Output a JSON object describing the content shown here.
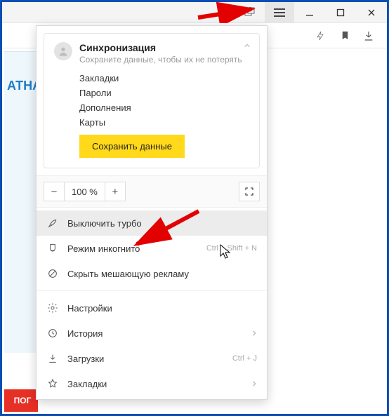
{
  "bg": {
    "left_text": "АТНА",
    "red_block": "ПОГ"
  },
  "sync": {
    "title": "Синхронизация",
    "subtitle": "Сохраните данные, чтобы их не потерять",
    "links": [
      "Закладки",
      "Пароли",
      "Дополнения",
      "Карты"
    ],
    "save_button": "Сохранить данные"
  },
  "zoom": {
    "minus": "−",
    "value": "100 %",
    "plus": "+"
  },
  "menu": {
    "turbo": "Выключить турбо",
    "incognito": "Режим инкогнито",
    "incognito_shortcut": "Ctrl + Shift + N",
    "hide_ads": "Скрыть мешающую рекламу",
    "settings": "Настройки",
    "history": "История",
    "downloads": "Загрузки",
    "downloads_shortcut": "Ctrl + J",
    "bookmarks": "Закладки"
  }
}
